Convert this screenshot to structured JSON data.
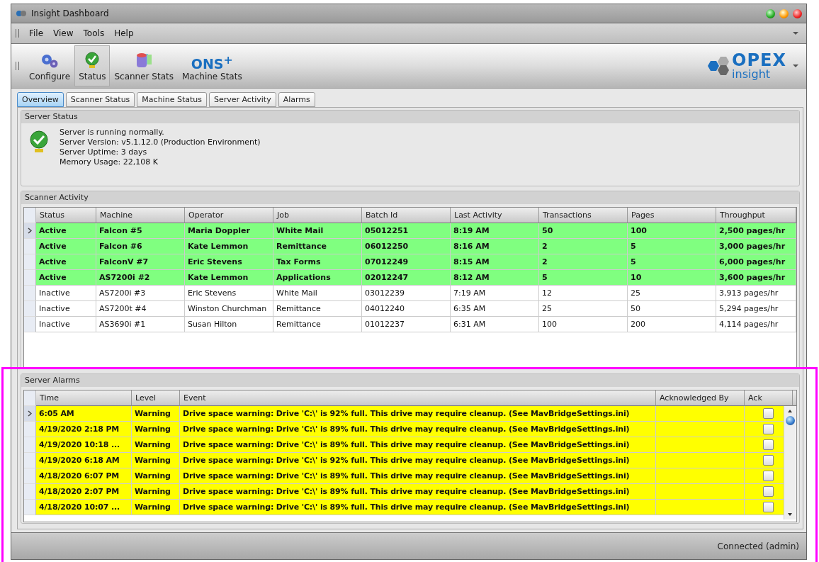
{
  "window": {
    "title": "Insight Dashboard"
  },
  "menu": [
    "File",
    "View",
    "Tools",
    "Help"
  ],
  "toolbar": [
    {
      "kind": "gears",
      "label": "Configure",
      "selected": false
    },
    {
      "kind": "status",
      "label": "Status",
      "selected": true
    },
    {
      "kind": "stats",
      "label": "Scanner Stats",
      "selected": false
    },
    {
      "kind": "ons",
      "glyph": "ONS$^{+}$",
      "label": "Machine Stats",
      "selected": false
    }
  ],
  "logo": {
    "name": "OPEX",
    "sub": "insight"
  },
  "tabs": [
    {
      "label": "Overview",
      "selected": true
    },
    {
      "label": "Scanner Status",
      "selected": false
    },
    {
      "label": "Machine Status",
      "selected": false
    },
    {
      "label": "Server Activity",
      "selected": false
    },
    {
      "label": "Alarms",
      "selected": false
    }
  ],
  "server_status": {
    "title": "Server Status",
    "lines": [
      "Server is running normally.",
      "Server Version: v5.1.12.0 (Production Environment)",
      "Server Uptime: 3 days",
      "Memory Usage: 22,108 K"
    ]
  },
  "scanner_activity": {
    "title": "Scanner Activity",
    "columns": [
      "Status",
      "Machine",
      "Operator",
      "Job",
      "Batch Id",
      "Last Activity",
      "Transactions",
      "Pages",
      "Throughput"
    ],
    "rows": [
      {
        "current": true,
        "active": true,
        "cells": [
          "Active",
          "Falcon #5",
          "Maria Doppler",
          "White Mail",
          "05012251",
          "8:19 AM",
          "50",
          "100",
          "2,500 pages/hr"
        ]
      },
      {
        "current": false,
        "active": true,
        "cells": [
          "Active",
          "Falcon #6",
          "Kate Lemmon",
          "Remittance",
          "06012250",
          "8:16 AM",
          "2",
          "5",
          "3,000 pages/hr"
        ]
      },
      {
        "current": false,
        "active": true,
        "cells": [
          "Active",
          "FalconV #7",
          "Eric Stevens",
          "Tax Forms",
          "07012249",
          "8:15 AM",
          "2",
          "5",
          "6,000 pages/hr"
        ]
      },
      {
        "current": false,
        "active": true,
        "cells": [
          "Active",
          "AS7200i #2",
          "Kate Lemmon",
          "Applications",
          "02012247",
          "8:12 AM",
          "5",
          "10",
          "3,600 pages/hr"
        ]
      },
      {
        "current": false,
        "active": false,
        "cells": [
          "Inactive",
          "AS7200i #3",
          "Eric Stevens",
          "White Mail",
          "03012239",
          "7:19 AM",
          "12",
          "25",
          "3,913 pages/hr"
        ]
      },
      {
        "current": false,
        "active": false,
        "cells": [
          "Inactive",
          "AS7200t #4",
          "Winston Churchman",
          "Remittance",
          "04012240",
          "6:35 AM",
          "25",
          "50",
          "5,294 pages/hr"
        ]
      },
      {
        "current": false,
        "active": false,
        "cells": [
          "Inactive",
          "AS3690i #1",
          "Susan Hilton",
          "Remittance",
          "01012237",
          "6:31 AM",
          "100",
          "200",
          "4,114 pages/hr"
        ]
      }
    ]
  },
  "server_alarms": {
    "title": "Server Alarms",
    "highlighted": true,
    "columns": [
      "Time",
      "Level",
      "Event",
      "Acknowledged By",
      "Ack"
    ],
    "rows": [
      {
        "current": true,
        "time": "6:05 AM",
        "level": "Warning",
        "event": "Drive space warning: Drive 'C:\\' is 92% full. This drive may require cleanup. (See MavBridgeSettings.ini)",
        "ack": false
      },
      {
        "current": false,
        "time": "4/19/2020 2:18 PM",
        "level": "Warning",
        "event": "Drive space warning: Drive 'C:\\' is 89% full. This drive may require cleanup. (See MavBridgeSettings.ini)",
        "ack": false
      },
      {
        "current": false,
        "time": "4/19/2020 10:18 ...",
        "level": "Warning",
        "event": "Drive space warning: Drive 'C:\\' is 89% full. This drive may require cleanup. (See MavBridgeSettings.ini)",
        "ack": false
      },
      {
        "current": false,
        "time": "4/19/2020 6:18 AM",
        "level": "Warning",
        "event": "Drive space warning: Drive 'C:\\' is 92% full. This drive may require cleanup. (See MavBridgeSettings.ini)",
        "ack": false
      },
      {
        "current": false,
        "time": "4/18/2020 6:07 PM",
        "level": "Warning",
        "event": "Drive space warning: Drive 'C:\\' is 89% full. This drive may require cleanup. (See MavBridgeSettings.ini)",
        "ack": false
      },
      {
        "current": false,
        "time": "4/18/2020 2:07 PM",
        "level": "Warning",
        "event": "Drive space warning: Drive 'C:\\' is 89% full. This drive may require cleanup. (See MavBridgeSettings.ini)",
        "ack": false
      },
      {
        "current": false,
        "time": "4/18/2020 10:07 ...",
        "level": "Warning",
        "event": "Drive space warning: Drive 'C:\\' is 89% full. This drive may require cleanup. (See MavBridgeSettings.ini)",
        "ack": false
      }
    ]
  },
  "status_bar": "Connected (admin)"
}
